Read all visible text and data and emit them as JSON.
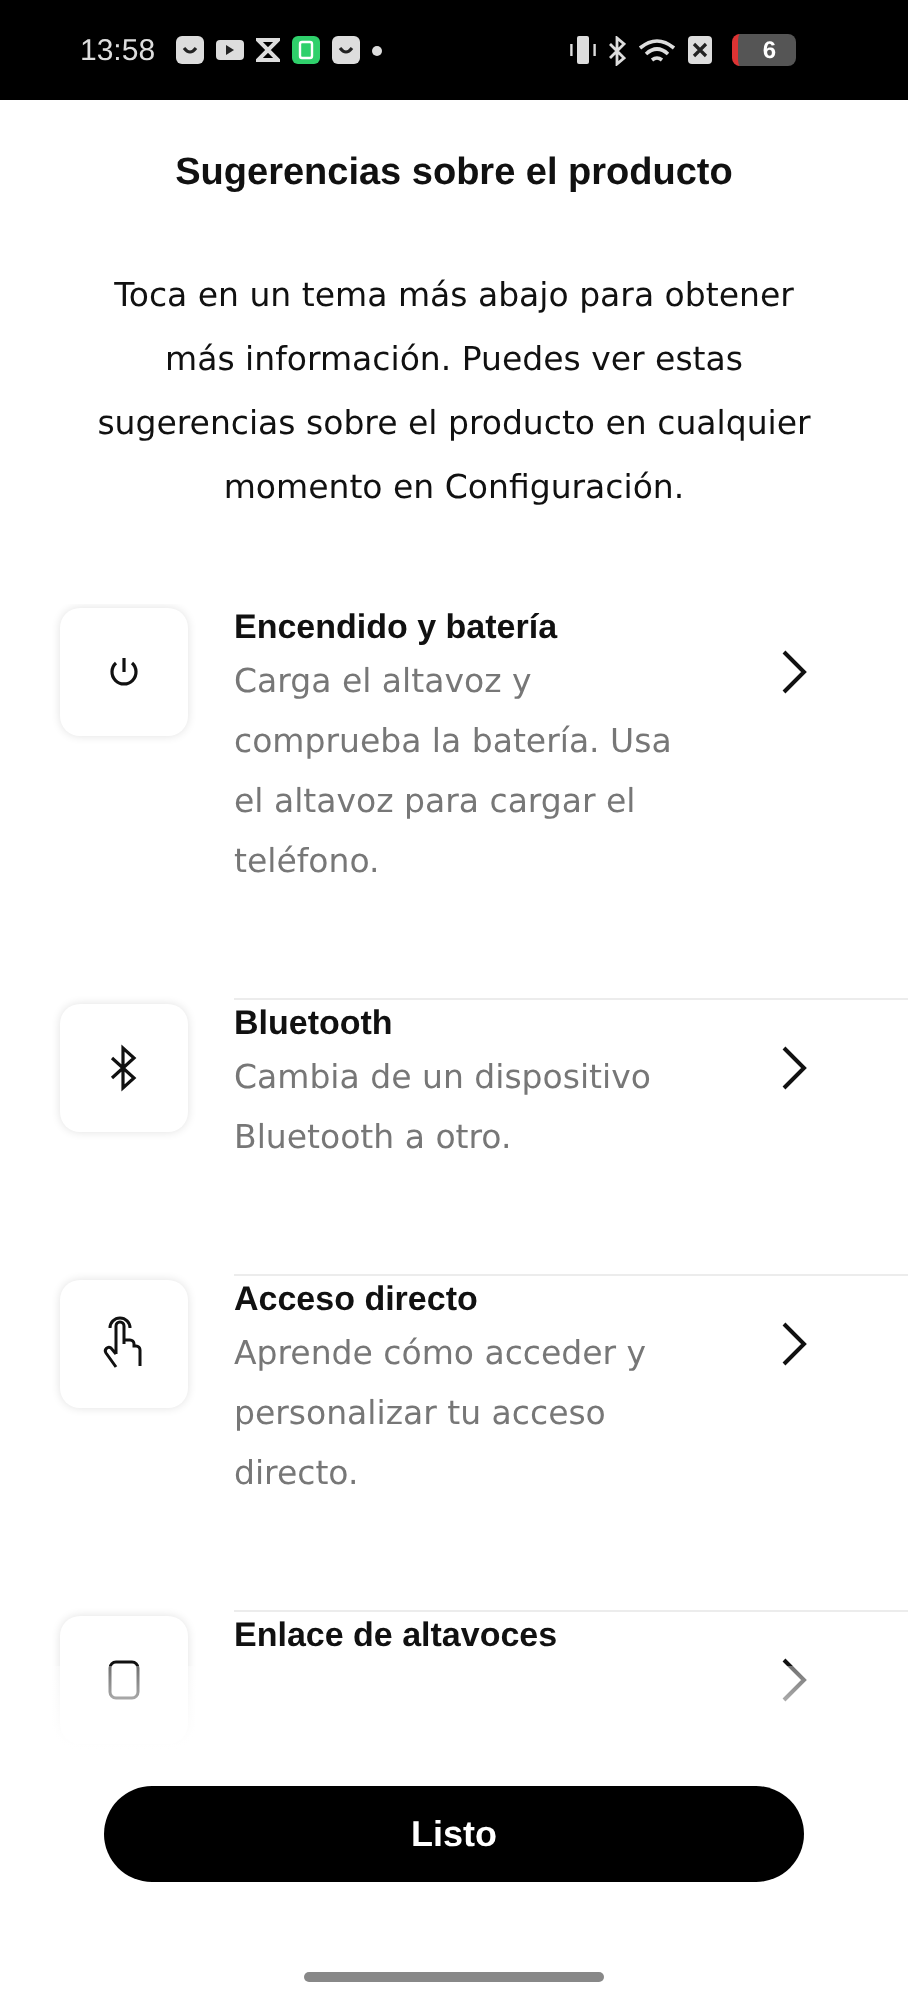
{
  "status_bar": {
    "time": "13:58",
    "battery": "6"
  },
  "title": "Sugerencias sobre el producto",
  "intro": "Toca en un tema más abajo para obtener más información. Puedes ver estas sugerencias sobre el producto en cualquier momento en Configuración.",
  "topics": [
    {
      "title": "Encendido y batería",
      "description": "Carga el altavoz y comprueba la batería. Usa el altavoz para cargar el teléfono."
    },
    {
      "title": "Bluetooth",
      "description": "Cambia de un dispositivo Bluetooth a otro."
    },
    {
      "title": "Acceso directo",
      "description": "Aprende cómo acceder y personalizar tu acceso directo."
    },
    {
      "title": "Enlace de altavoces"
    }
  ],
  "done_button": "Listo"
}
